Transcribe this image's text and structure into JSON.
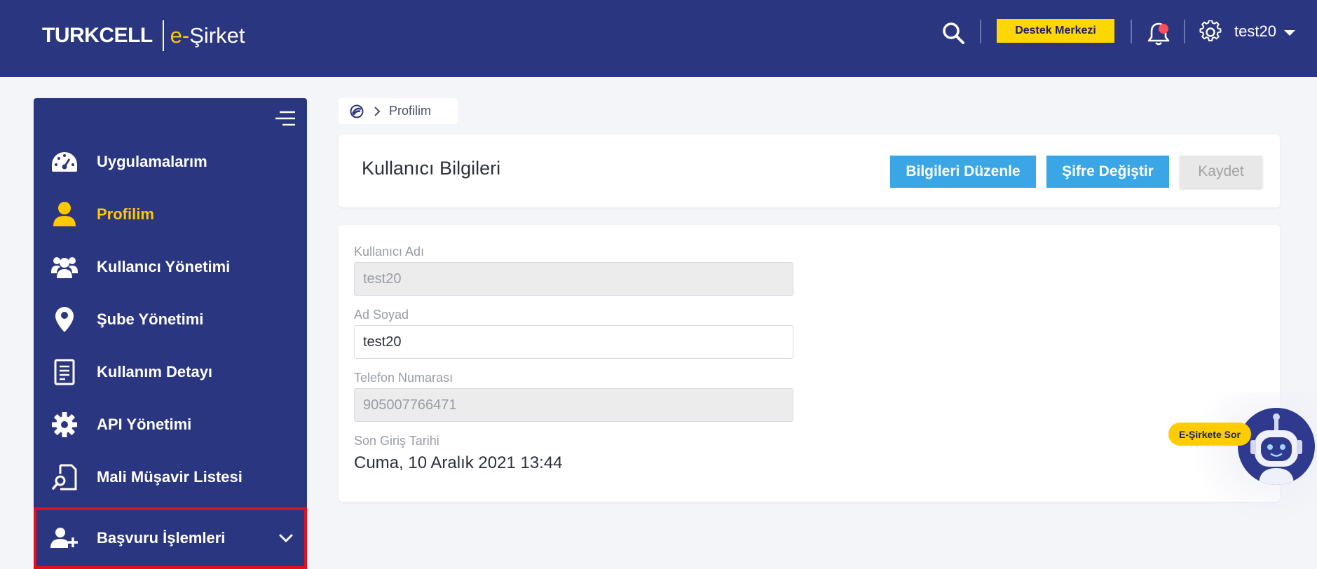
{
  "header": {
    "brand": "TURKCELL",
    "product_prefix": "e-",
    "product_name": "Şirket",
    "support_label": "Destek Merkezi",
    "username": "test20"
  },
  "sidebar": {
    "items": [
      {
        "label": "Uygulamalarım",
        "icon": "speedometer-icon"
      },
      {
        "label": "Profilim",
        "icon": "user-icon",
        "active": true
      },
      {
        "label": "Kullanıcı Yönetimi",
        "icon": "users-icon"
      },
      {
        "label": "Şube Yönetimi",
        "icon": "map-pin-icon"
      },
      {
        "label": "Kullanım Detayı",
        "icon": "document-icon"
      },
      {
        "label": "API Yönetimi",
        "icon": "gear-icon"
      },
      {
        "label": "Mali Müşavir Listesi",
        "icon": "document-search-icon"
      },
      {
        "label": "Başvuru İşlemleri",
        "icon": "user-add-icon",
        "expandable": true
      }
    ]
  },
  "breadcrumb": {
    "current": "Profilim"
  },
  "profile_card": {
    "title": "Kullanıcı Bilgileri",
    "edit_label": "Bilgileri Düzenle",
    "password_label": "Şifre Değiştir",
    "save_label": "Kaydet"
  },
  "form": {
    "username_label": "Kullanıcı Adı",
    "username_value": "test20",
    "fullname_label": "Ad Soyad",
    "fullname_value": "test20",
    "phone_label": "Telefon Numarası",
    "phone_value": "905007766471",
    "last_login_label": "Son Giriş Tarihi",
    "last_login_value": "Cuma, 10 Aralık 2021 13:44"
  },
  "bot": {
    "label": "E-Şirkete Sor"
  },
  "colors": {
    "header_bg": "#2a3680",
    "accent_yellow": "#ffd700",
    "button_blue": "#3ba6e6",
    "active_nav": "#ffc900",
    "highlight_border": "#e0101e"
  }
}
